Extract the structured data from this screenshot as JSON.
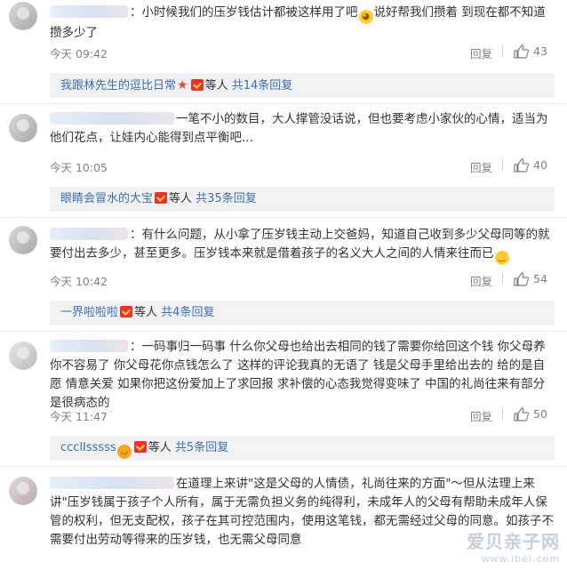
{
  "comments": [
    {
      "text_a": "：小时候我们的压岁钱估计都被这样用了吧",
      "emoji": "cat-emoji",
      "text_b": "说好帮我们攒着 到现在都不知道攒多少了",
      "time": "今天 09:42",
      "reply": "回复",
      "likes": "43"
    },
    {
      "text_a": "一笔不小的数目，大人撑管没话说，但也要考虑小家伙的心情，适当为他们花点，让娃内心能得到点平衡吧...",
      "time": "今天 10:05",
      "reply": "回复",
      "likes": "40"
    },
    {
      "text_a": "：有什么问题，从小拿了压岁钱主动上交爸妈，知道自己收到多少父母同等的就要付出去多少，甚至更多。压岁钱本来就是借着孩子的名义大人之间的人情来往而已",
      "emoji": "smile-emoji",
      "time": "今天 10:42",
      "reply": "回复",
      "likes": "54"
    },
    {
      "text_a": "：一码事归一码事 什么你父母也给出去相同的钱了需要你给回这个钱 你父母养你不容易了 你父母花你点钱怎么了 这样的评论我真的无语了 钱是父母手里给出去的 给的是自愿 情意关爱 如果你把这份爱加上了求回报 求补偿的心态我觉得变味了 中国的礼尚往来有部分是很病态的",
      "time": "今天 11:47",
      "reply": "回复",
      "likes": "50"
    },
    {
      "text_a": "在道理上来讲\"这是父母的人情债，礼尚往来的方面\"～但从法理上来讲\"压岁钱属于孩子个人所有，属于无需负担义务的纯得利，未成年人的父母有帮助未成年人保管的权利，但无支配权，孩子在其可控范围内，使用这笔钱，都无需经过父母的同意。如孩子不需要付出劳动等得来的压岁钱，也无需父母同意"
    }
  ],
  "subs": [
    {
      "user": "我跟林先生的逗比日常",
      "star": "★",
      "suffix": "等人",
      "total": "共14条回复"
    },
    {
      "user": "眼睛会冒水的大宝",
      "suffix": "等人",
      "total": "共35条回复"
    },
    {
      "user": "一界啦啦啦",
      "suffix": "等人",
      "total": "共4条回复"
    },
    {
      "user": "ccclIsssss",
      "suffix": "等人",
      "total": "共5条回复"
    }
  ],
  "watermark": {
    "line1": "爱贝亲子网",
    "line2": "www.ibei.com"
  },
  "colors": {
    "link": "#3b71b0",
    "meta": "#808080",
    "subbox_bg": "#f2f2f5",
    "badge": "#e8342e"
  }
}
